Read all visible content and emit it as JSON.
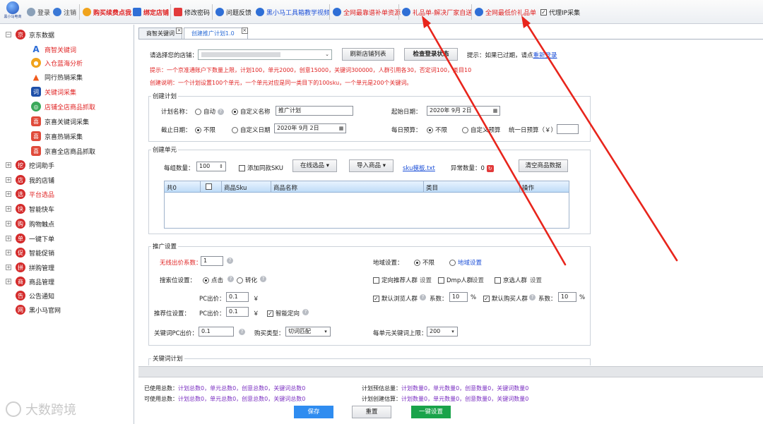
{
  "toolbar": {
    "logo": "黑小马电商",
    "items": [
      {
        "label": "登录",
        "color": "#555"
      },
      {
        "label": "注销",
        "color": "#555"
      },
      {
        "label": "购买续费点我",
        "color": "#e02424"
      },
      {
        "label": "绑定店铺",
        "color": "#e02424"
      },
      {
        "label": "修改密码",
        "color": "#222"
      },
      {
        "label": "问题反馈",
        "color": "#222"
      },
      {
        "label": "黑小马工具箱教学视频",
        "color": "#1f52d8"
      },
      {
        "label": "全网最靠谱补单资源",
        "color": "#e02424"
      },
      {
        "label": "礼品单-解决厂家自送",
        "color": "#e02424"
      },
      {
        "label": "全网最低价礼品单",
        "color": "#e02424"
      }
    ],
    "proxy_label": "代理IP采集",
    "proxy_checked": true
  },
  "sidebar": {
    "root": "京东数据",
    "children": [
      "商智关键词",
      "入仓蓝海分析",
      "同行热销采集",
      "关键词采集",
      "店铺全店商品抓取",
      "京喜关键词采集",
      "京喜热销采集",
      "京喜全店商品抓取"
    ],
    "groups": [
      "挖词助手",
      "我的店铺",
      "平台选品",
      "智能快车",
      "购物触点",
      "一键下单",
      "智能促销",
      "拼购管理",
      "商品管理",
      "公告通知",
      "黑小马官网"
    ]
  },
  "tabs": [
    {
      "label": "商智关键词"
    },
    {
      "label": "创建推广计划1.0"
    }
  ],
  "shop": {
    "label": "请选择您的店铺：",
    "value": "",
    "refresh_btn": "刷新店铺列表",
    "check_btn": "检查登录状态",
    "hint": "提示：如果已过期，请点",
    "hint_link": "重新登录"
  },
  "tips": {
    "line1": "提示：一个京准通账户下数量上限，计划100，单元2000，创意15000，关键词300000，人群引用各30，否定词100，类目10",
    "line2": "创建说明：一个计划设置100个单元，一个单元对应是同一类目下的100sku，一个单元是200个关键词。"
  },
  "plan": {
    "legend": "创建计划",
    "name_label": "计划名称：",
    "auto": "自动",
    "custom": "自定义名称",
    "name_value": "推广计划",
    "start_label": "起始日期：",
    "start_value": "2020年 9月 2日",
    "end_label": "截止日期：",
    "unlimited": "不限",
    "custom_date": "自定义日期",
    "end_value": "2020年 9月 2日",
    "budget_label": "每日预算：",
    "budget_unlimited": "不限",
    "budget_custom": "自定义预算",
    "unified_label": "统一日预算（￥）",
    "unified_value": ""
  },
  "unit": {
    "legend": "创建单元",
    "per_group_label": "每组数量：",
    "per_group_value": "100",
    "add_same": "添加同款SKU",
    "online_btn": "在线选品",
    "import_btn": "导入商品",
    "template_link": "sku模板.txt",
    "abnormal_label": "异常数量：0",
    "clear_btn": "清空商品数据",
    "columns": [
      "共0",
      "",
      "商品Sku",
      "商品名称",
      "类目",
      "操作"
    ]
  },
  "promo": {
    "legend": "推广设置",
    "wireless_label": "无线出价系数：",
    "wireless_value": "1",
    "region_label": "地域设置：",
    "region_unlimited": "不限",
    "region_setting": "地域设置",
    "search_label": "搜索位设置：",
    "click": "点击",
    "convert": "转化",
    "audience1": "定向推荐人群",
    "audience1_set": "设置",
    "audience2": "Dmp人群",
    "audience2_set": "设置",
    "audience3": "京选人群",
    "audience3_set": "设置",
    "pc_price_label": "PC出价：",
    "pc_price_value": "0.1",
    "yen": "￥",
    "default_browse": "默认浏览人群",
    "coef_label": "系数：",
    "browse_coef": "10",
    "percent": "%",
    "default_buy": "默认购买人群",
    "buy_coef": "10",
    "recommend_label": "推荐位设置：",
    "rec_pc_label": "PC出价：",
    "rec_pc_value": "0.1",
    "smart_target": "智能定向",
    "kw_pc_label": "关键词PC出价：",
    "kw_pc_value": "0.1",
    "buy_type_label": "购买类型：",
    "buy_type_value": "切词匹配",
    "unit_kw_label": "每单元关键词上限：",
    "unit_kw_value": "200"
  },
  "kwplan": {
    "legend": "关键词计划"
  },
  "footer": {
    "used_label": "已使用总数：",
    "used_values": "计划总数0，单元总数0，创意总数0，关键词总数0",
    "avail_label": "可使用总数：",
    "avail_values": "计划总数0，单元总数0，创意总数0，关键词总数0",
    "est_label": "计划预估总量：",
    "est_values": "计划数量0，单元数量0，创意数量0，关键词数量0",
    "create_label": "计划创建估算：",
    "create_values": "计划数量0，单元数量0，创意数量0，关键词数量0",
    "save_btn": "保存",
    "reset_btn": "重置",
    "oneclick_btn": "一键设置"
  },
  "watermark": "大数跨境"
}
